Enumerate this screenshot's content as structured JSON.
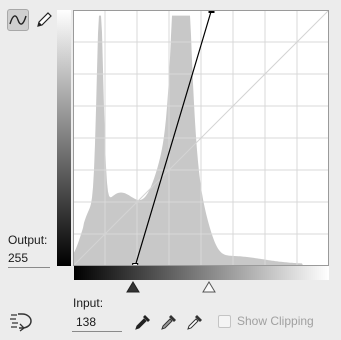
{
  "output": {
    "label": "Output:",
    "value": "255"
  },
  "input": {
    "label": "Input:",
    "value": "138"
  },
  "show_clipping": {
    "label": "Show Clipping",
    "checked": false,
    "enabled": false
  },
  "tools": [
    {
      "name": "curve-edit-icon",
      "selected": true
    },
    {
      "name": "pencil-icon",
      "selected": false
    }
  ],
  "curve": {
    "points": [
      [
        0,
        0
      ],
      [
        62,
        0
      ],
      [
        138,
        255
      ],
      [
        255,
        255
      ]
    ]
  },
  "colors": {
    "background": "#ececec",
    "histogram": "#c8c8c8",
    "curve": "#000000",
    "baseline": "#d4d4d4"
  }
}
